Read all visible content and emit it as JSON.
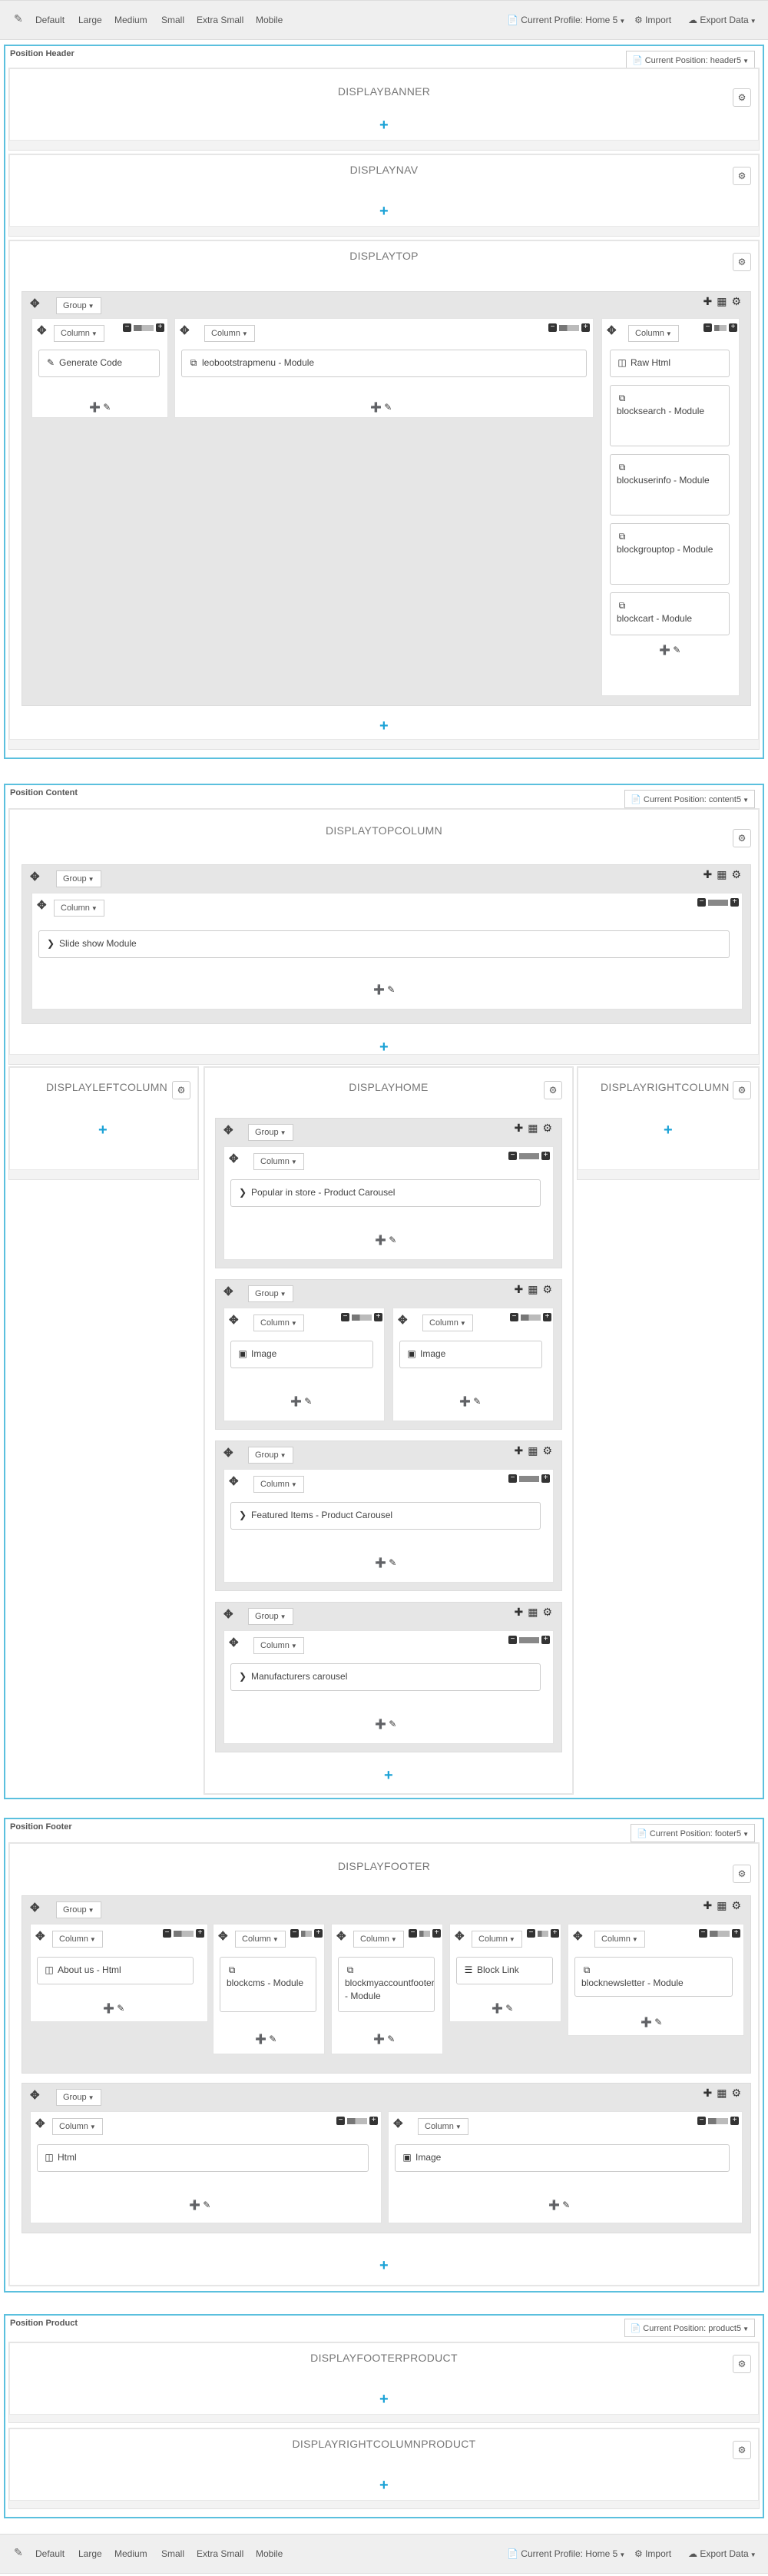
{
  "toolbar": {
    "devices": [
      "Default",
      "Large",
      "Medium",
      "Small",
      "Extra Small",
      "Mobile"
    ],
    "profile": "Current Profile: Home 5",
    "import": "Import",
    "export": "Export Data"
  },
  "common": {
    "group": "Group",
    "column": "Column"
  },
  "header": {
    "title": "Position Header",
    "current": "Current Position: header5",
    "hooks": {
      "banner": "DISPLAYBANNER",
      "nav": "DISPLAYNAV",
      "top": "DISPLAYTOP"
    },
    "modules": {
      "generate_code": "Generate Code",
      "leobootstrapmenu": "leobootstrapmenu - Module",
      "raw_html": "Raw Html",
      "blocksearch": "blocksearch - Module",
      "blockuserinfo": "blockuserinfo - Module",
      "blockgrouptop": "blockgrouptop - Module",
      "blockcart": "blockcart - Module"
    }
  },
  "content": {
    "title": "Position Content",
    "current": "Current Position: content5",
    "hooks": {
      "topcolumn": "DISPLAYTOPCOLUMN",
      "left": "DISPLAYLEFTCOLUMN",
      "home": "DISPLAYHOME",
      "right": "DISPLAYRIGHTCOLUMN"
    },
    "modules": {
      "slideshow": "Slide show Module",
      "popular": "Popular in store - Product Carousel",
      "image1": "Image",
      "image2": "Image",
      "featured": "Featured Items - Product Carousel",
      "manufacturers": "Manufacturers carousel"
    }
  },
  "footer": {
    "title": "Position Footer",
    "current": "Current Position: footer5",
    "hooks": {
      "footer": "DISPLAYFOOTER"
    },
    "modules": {
      "about": "About us - Html",
      "blockcms": "blockcms - Module",
      "blockmyaccount": "blockmyaccountfooter - Module",
      "blocklink": "Block Link",
      "newsletter": "blocknewsletter - Module",
      "html": "Html",
      "image": "Image"
    }
  },
  "product": {
    "title": "Position Product",
    "current": "Current Position: product5",
    "hooks": {
      "footerproduct": "DISPLAYFOOTERPRODUCT",
      "rightcolumnproduct": "DISPLAYRIGHTCOLUMNPRODUCT"
    }
  },
  "icons": {
    "tool": "wrench-icon",
    "drag": "move-icon",
    "gear": "gear-icon",
    "add": "plus-icon",
    "grid": "grid-icon",
    "edit": "pencil-icon",
    "module": "copy-icon",
    "html": "html5-icon",
    "image": "image-icon",
    "code": "edit-icon",
    "carousel": "chevron-right-icon",
    "link": "list-icon"
  },
  "colors": {
    "accent": "#5bc0de",
    "plus": "#1ba2d6"
  }
}
